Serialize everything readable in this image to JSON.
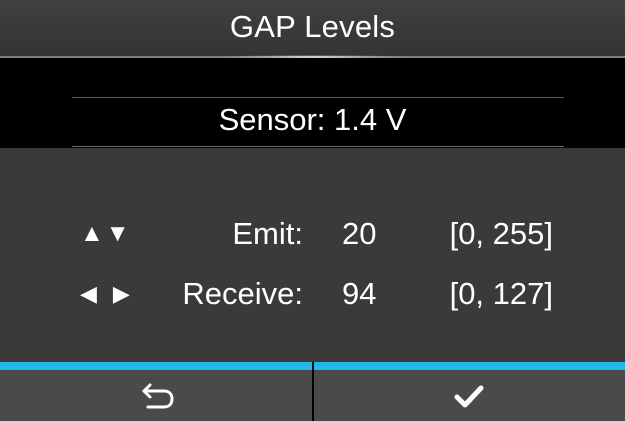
{
  "header": {
    "title": "GAP Levels"
  },
  "sensor": {
    "text": "Sensor: 1.4 V"
  },
  "settings": {
    "emit": {
      "label": "Emit:",
      "value": "20",
      "range": "[0, 255]",
      "arrow_icons": [
        "up-arrow-icon",
        "down-arrow-icon"
      ]
    },
    "receive": {
      "label": "Receive:",
      "value": "94",
      "range": "[0, 127]",
      "arrow_icons": [
        "left-arrow-icon",
        "right-arrow-icon"
      ]
    }
  },
  "footer": {
    "back_icon": "back-return-icon",
    "confirm_icon": "checkmark-icon"
  },
  "colors": {
    "accent": "#20b8e8",
    "background": "#3a3a3a",
    "panel": "#000000",
    "footer_button": "#4a4a4a",
    "text": "#ffffff"
  },
  "glyphs": {
    "up": "▲",
    "down": "▼",
    "left": "◀",
    "right": "▶"
  }
}
